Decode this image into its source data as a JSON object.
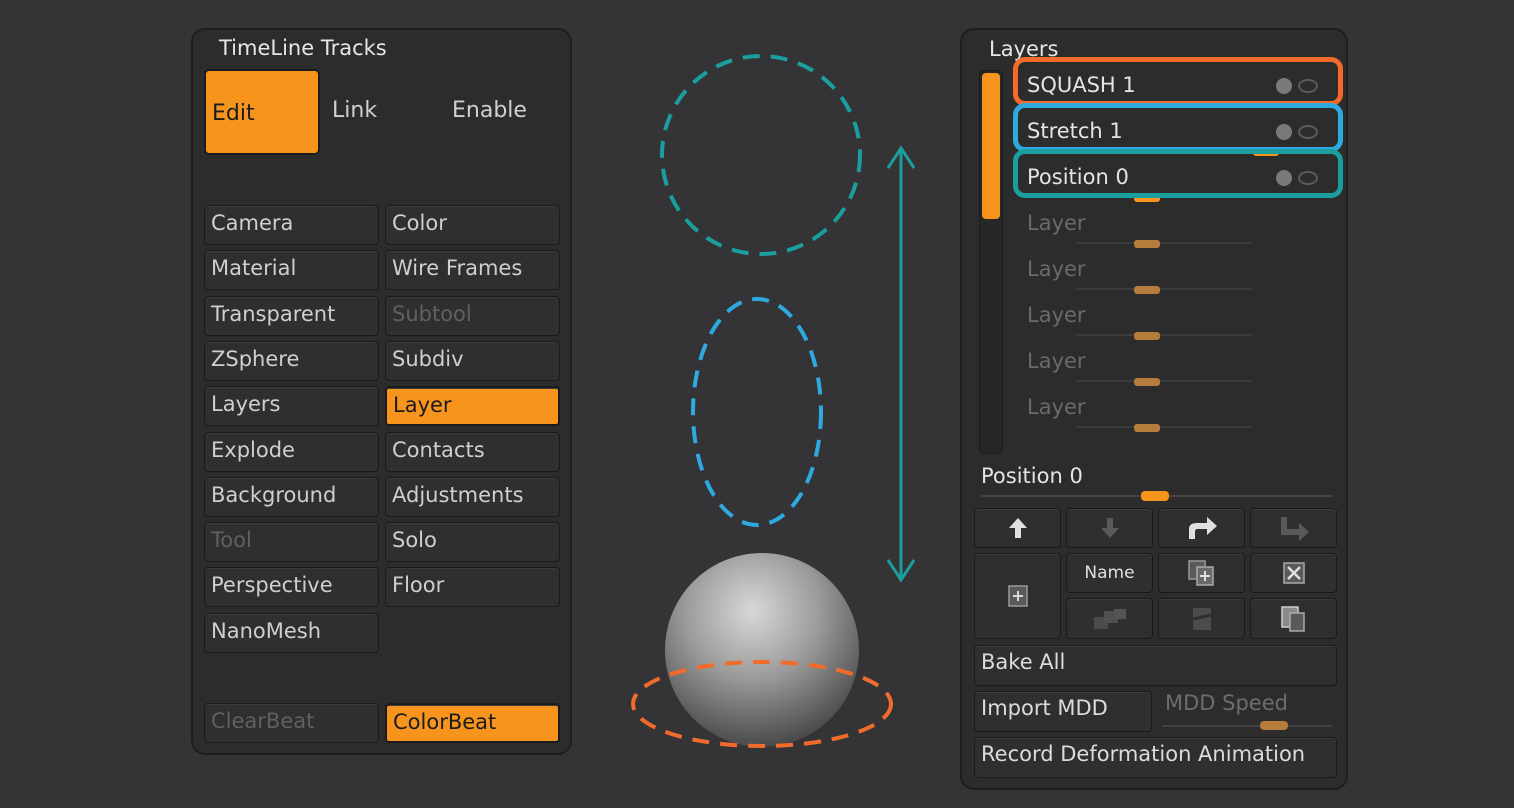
{
  "timeline": {
    "title": "TimeLine Tracks",
    "edit": "Edit",
    "link": "Link",
    "enable": "Enable",
    "buttons": [
      {
        "label": "Camera",
        "state": "normal"
      },
      {
        "label": "Color",
        "state": "normal"
      },
      {
        "label": "Material",
        "state": "normal"
      },
      {
        "label": "Wire Frames",
        "state": "normal"
      },
      {
        "label": "Transparent",
        "state": "normal"
      },
      {
        "label": "Subtool",
        "state": "dim"
      },
      {
        "label": "ZSphere",
        "state": "normal"
      },
      {
        "label": "Subdiv",
        "state": "normal"
      },
      {
        "label": "Layers",
        "state": "normal"
      },
      {
        "label": "Layer",
        "state": "active"
      },
      {
        "label": "Explode",
        "state": "normal"
      },
      {
        "label": "Contacts",
        "state": "normal"
      },
      {
        "label": "Background",
        "state": "normal"
      },
      {
        "label": "Adjustments",
        "state": "normal"
      },
      {
        "label": "Tool",
        "state": "dim"
      },
      {
        "label": "Solo",
        "state": "normal"
      },
      {
        "label": "Perspective",
        "state": "normal"
      },
      {
        "label": "Floor",
        "state": "normal"
      },
      {
        "label": "NanoMesh",
        "state": "normal"
      }
    ],
    "clearbeat": "ClearBeat",
    "colorbeat": "ColorBeat"
  },
  "layers": {
    "title": "Layers",
    "rows": [
      {
        "label": "SQUASH 1",
        "active": true,
        "highlight": "#f26b2a"
      },
      {
        "label": "Stretch 1",
        "active": true,
        "highlight": "#2eaae1"
      },
      {
        "label": "Position 0",
        "active": true,
        "highlight": "#1a9e9e"
      },
      {
        "label": "Layer",
        "active": false
      },
      {
        "label": "Layer",
        "active": false
      },
      {
        "label": "Layer",
        "active": false
      },
      {
        "label": "Layer",
        "active": false
      },
      {
        "label": "Layer",
        "active": false
      }
    ],
    "position_label": "Position 0",
    "name_label": "Name",
    "bake_all": "Bake All",
    "import_mdd": "Import MDD",
    "mdd_speed": "MDD Speed",
    "record": "Record Deformation Animation"
  },
  "colors": {
    "accent": "#f7941e",
    "teal": "#1a9e9e",
    "blue": "#2eaae1",
    "orange": "#f26b2a"
  },
  "icons": [
    "arrow-up-icon",
    "arrow-down-icon",
    "redo-arrow-icon",
    "turn-arrow-icon",
    "new-layer-icon",
    "duplicate-icon",
    "delete-icon",
    "merge-down-icon",
    "split-icon",
    "copy-icon"
  ]
}
